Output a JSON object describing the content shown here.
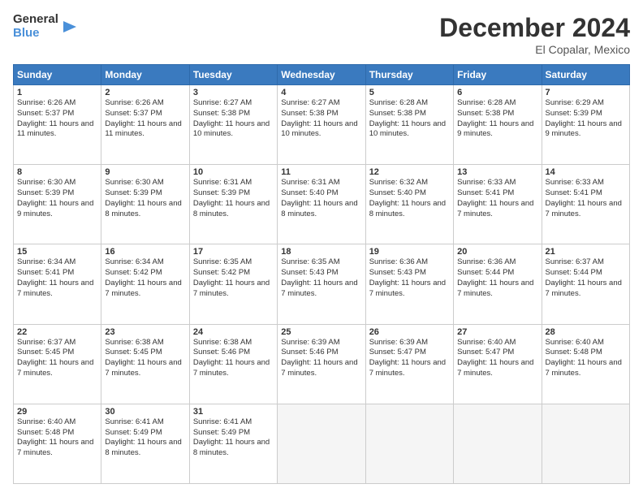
{
  "header": {
    "logo_text_general": "General",
    "logo_text_blue": "Blue",
    "month_title": "December 2024",
    "location": "El Copalar, Mexico"
  },
  "days_of_week": [
    "Sunday",
    "Monday",
    "Tuesday",
    "Wednesday",
    "Thursday",
    "Friday",
    "Saturday"
  ],
  "weeks": [
    [
      {
        "day": "1",
        "sunrise": "6:26 AM",
        "sunset": "5:37 PM",
        "daylight": "11 hours and 11 minutes."
      },
      {
        "day": "2",
        "sunrise": "6:26 AM",
        "sunset": "5:37 PM",
        "daylight": "11 hours and 11 minutes."
      },
      {
        "day": "3",
        "sunrise": "6:27 AM",
        "sunset": "5:38 PM",
        "daylight": "11 hours and 10 minutes."
      },
      {
        "day": "4",
        "sunrise": "6:27 AM",
        "sunset": "5:38 PM",
        "daylight": "11 hours and 10 minutes."
      },
      {
        "day": "5",
        "sunrise": "6:28 AM",
        "sunset": "5:38 PM",
        "daylight": "11 hours and 10 minutes."
      },
      {
        "day": "6",
        "sunrise": "6:28 AM",
        "sunset": "5:38 PM",
        "daylight": "11 hours and 9 minutes."
      },
      {
        "day": "7",
        "sunrise": "6:29 AM",
        "sunset": "5:39 PM",
        "daylight": "11 hours and 9 minutes."
      }
    ],
    [
      {
        "day": "8",
        "sunrise": "6:30 AM",
        "sunset": "5:39 PM",
        "daylight": "11 hours and 9 minutes."
      },
      {
        "day": "9",
        "sunrise": "6:30 AM",
        "sunset": "5:39 PM",
        "daylight": "11 hours and 8 minutes."
      },
      {
        "day": "10",
        "sunrise": "6:31 AM",
        "sunset": "5:39 PM",
        "daylight": "11 hours and 8 minutes."
      },
      {
        "day": "11",
        "sunrise": "6:31 AM",
        "sunset": "5:40 PM",
        "daylight": "11 hours and 8 minutes."
      },
      {
        "day": "12",
        "sunrise": "6:32 AM",
        "sunset": "5:40 PM",
        "daylight": "11 hours and 8 minutes."
      },
      {
        "day": "13",
        "sunrise": "6:33 AM",
        "sunset": "5:41 PM",
        "daylight": "11 hours and 7 minutes."
      },
      {
        "day": "14",
        "sunrise": "6:33 AM",
        "sunset": "5:41 PM",
        "daylight": "11 hours and 7 minutes."
      }
    ],
    [
      {
        "day": "15",
        "sunrise": "6:34 AM",
        "sunset": "5:41 PM",
        "daylight": "11 hours and 7 minutes."
      },
      {
        "day": "16",
        "sunrise": "6:34 AM",
        "sunset": "5:42 PM",
        "daylight": "11 hours and 7 minutes."
      },
      {
        "day": "17",
        "sunrise": "6:35 AM",
        "sunset": "5:42 PM",
        "daylight": "11 hours and 7 minutes."
      },
      {
        "day": "18",
        "sunrise": "6:35 AM",
        "sunset": "5:43 PM",
        "daylight": "11 hours and 7 minutes."
      },
      {
        "day": "19",
        "sunrise": "6:36 AM",
        "sunset": "5:43 PM",
        "daylight": "11 hours and 7 minutes."
      },
      {
        "day": "20",
        "sunrise": "6:36 AM",
        "sunset": "5:44 PM",
        "daylight": "11 hours and 7 minutes."
      },
      {
        "day": "21",
        "sunrise": "6:37 AM",
        "sunset": "5:44 PM",
        "daylight": "11 hours and 7 minutes."
      }
    ],
    [
      {
        "day": "22",
        "sunrise": "6:37 AM",
        "sunset": "5:45 PM",
        "daylight": "11 hours and 7 minutes."
      },
      {
        "day": "23",
        "sunrise": "6:38 AM",
        "sunset": "5:45 PM",
        "daylight": "11 hours and 7 minutes."
      },
      {
        "day": "24",
        "sunrise": "6:38 AM",
        "sunset": "5:46 PM",
        "daylight": "11 hours and 7 minutes."
      },
      {
        "day": "25",
        "sunrise": "6:39 AM",
        "sunset": "5:46 PM",
        "daylight": "11 hours and 7 minutes."
      },
      {
        "day": "26",
        "sunrise": "6:39 AM",
        "sunset": "5:47 PM",
        "daylight": "11 hours and 7 minutes."
      },
      {
        "day": "27",
        "sunrise": "6:40 AM",
        "sunset": "5:47 PM",
        "daylight": "11 hours and 7 minutes."
      },
      {
        "day": "28",
        "sunrise": "6:40 AM",
        "sunset": "5:48 PM",
        "daylight": "11 hours and 7 minutes."
      }
    ],
    [
      {
        "day": "29",
        "sunrise": "6:40 AM",
        "sunset": "5:48 PM",
        "daylight": "11 hours and 7 minutes."
      },
      {
        "day": "30",
        "sunrise": "6:41 AM",
        "sunset": "5:49 PM",
        "daylight": "11 hours and 8 minutes."
      },
      {
        "day": "31",
        "sunrise": "6:41 AM",
        "sunset": "5:49 PM",
        "daylight": "11 hours and 8 minutes."
      },
      null,
      null,
      null,
      null
    ]
  ],
  "labels": {
    "sunrise": "Sunrise: ",
    "sunset": "Sunset: ",
    "daylight": "Daylight: "
  }
}
